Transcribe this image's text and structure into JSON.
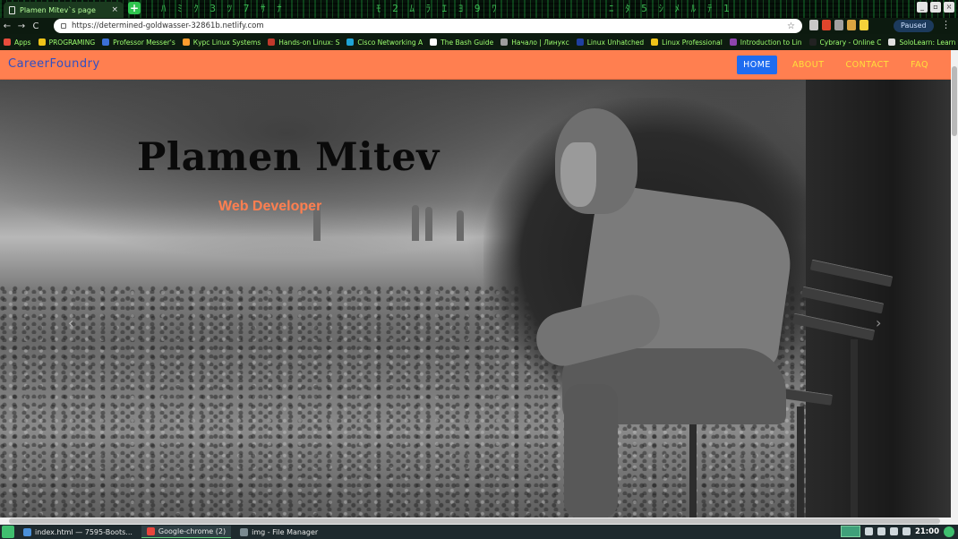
{
  "browser": {
    "tab_title": "Plamen Mitev`s page",
    "tab_close": "×",
    "new_tab": "+",
    "window_controls": [
      "_",
      "▫",
      "×"
    ],
    "nav_back": "←",
    "nav_forward": "→",
    "reload": "C",
    "url": "https://determined-goldwasser-32861b.netlify.com",
    "profile_status": "Paused",
    "menu": "⋮",
    "bookmarks": [
      {
        "label": "Apps",
        "color": "#e74c3c"
      },
      {
        "label": "PROGRAMING",
        "color": "#f0c419"
      },
      {
        "label": "Professor Messer's",
        "color": "#3b6fd6"
      },
      {
        "label": "Курс Linux Systems",
        "color": "#ff9d2e"
      },
      {
        "label": "Hands-on Linux: S",
        "color": "#c0392b"
      },
      {
        "label": "Cisco Networking A",
        "color": "#1fa4d6"
      },
      {
        "label": "The Bash Guide",
        "color": "#ffffff"
      },
      {
        "label": "Начало | Линукс",
        "color": "#9e9e9e"
      },
      {
        "label": "Linux Unhatched",
        "color": "#1f3fa0"
      },
      {
        "label": "Linux Professional",
        "color": "#f0c419"
      },
      {
        "label": "Introduction to Lin",
        "color": "#8e44ad"
      },
      {
        "label": "Cybrary - Online C",
        "color": "#222222"
      },
      {
        "label": "SoloLearn: Learn t",
        "color": "#e0e0e0"
      }
    ],
    "bookmarks_more": "»"
  },
  "site": {
    "brand": "CareerFoundry",
    "nav": [
      {
        "label": "HOME",
        "active": true
      },
      {
        "label": "ABOUT",
        "active": false
      },
      {
        "label": "CONTACT",
        "active": false
      },
      {
        "label": "FAQ",
        "active": false
      }
    ],
    "hero_title": "Plamen Mitev",
    "hero_subtitle": "Web Developer",
    "carousel_prev": "‹",
    "carousel_next": "›"
  },
  "taskbar": {
    "tasks": [
      {
        "label": "index.html — 7595-Boots...",
        "color": "#4a90d9",
        "active": false
      },
      {
        "label": "Google-chrome (2)",
        "color": "#e8453c",
        "active": true
      },
      {
        "label": "img - File Manager",
        "color": "#7a8a90",
        "active": false
      }
    ],
    "clock": "21:00"
  },
  "colors": {
    "nav_bg": "#ff7f50",
    "nav_link": "#ffe03a",
    "nav_active_bg": "#1e6cf0",
    "brand": "#2e4fc4",
    "subtitle": "#ff7f50"
  }
}
